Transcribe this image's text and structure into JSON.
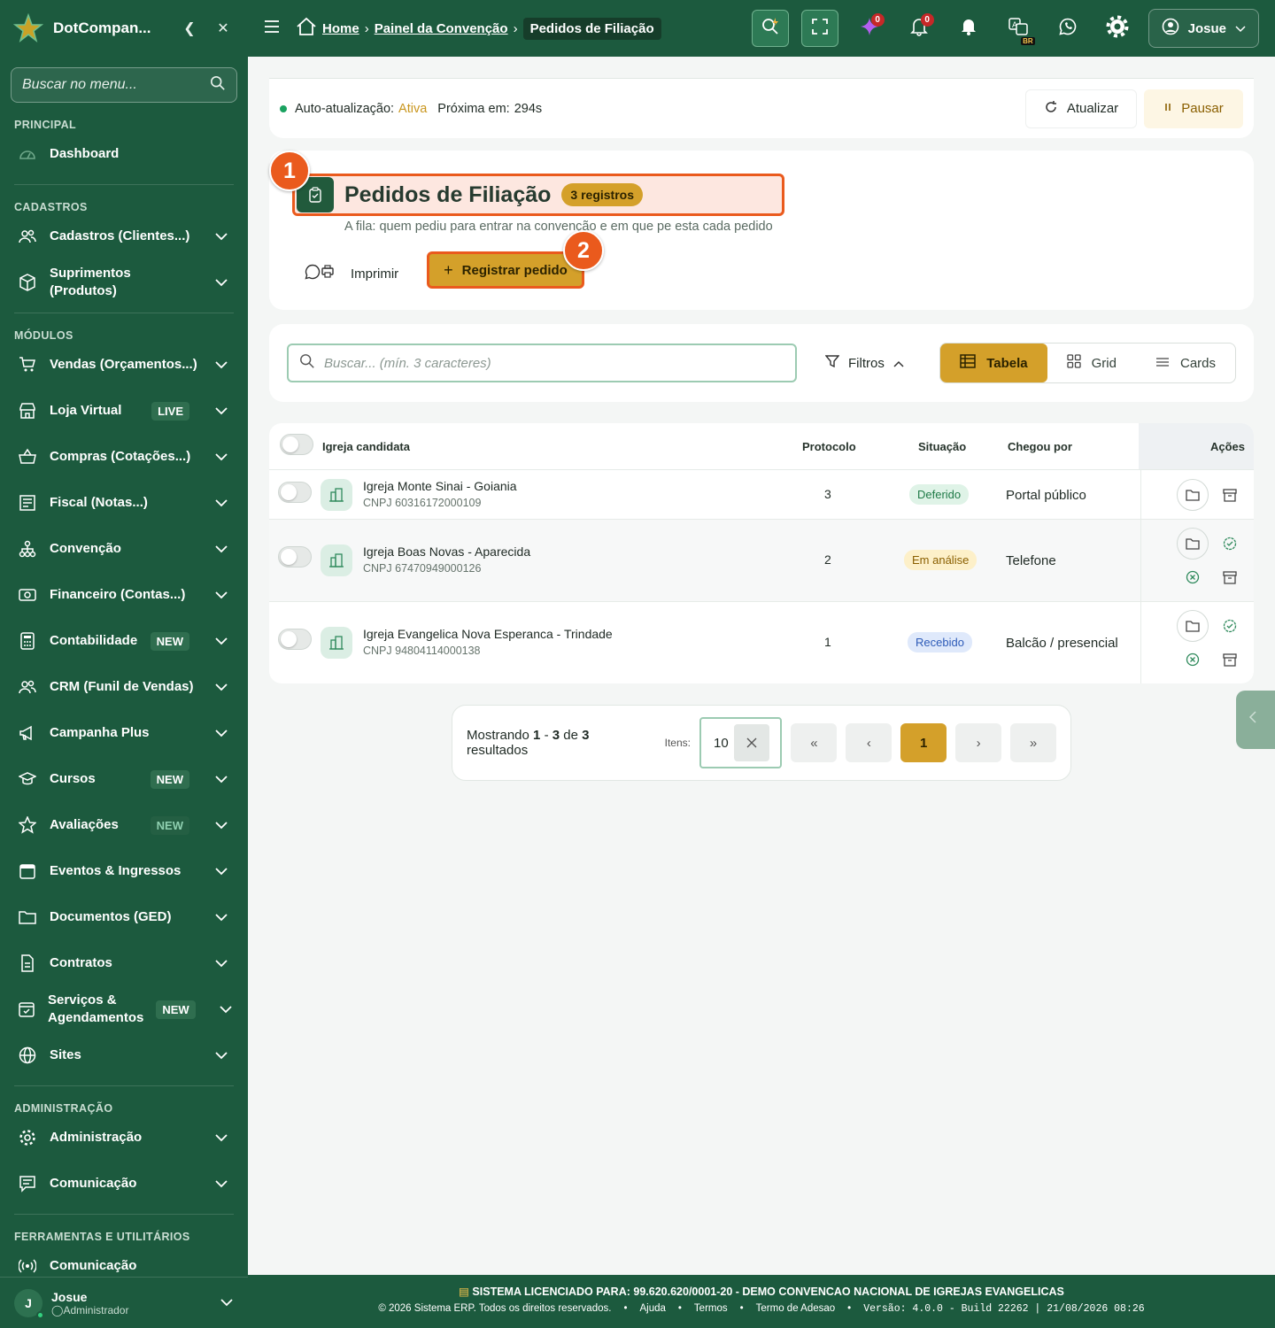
{
  "sidebar": {
    "brand": "DotCompan...",
    "search_placeholder": "Buscar no menu...",
    "sections": {
      "principal": "PRINCIPAL",
      "cadastros": "CADASTROS",
      "modulos": "MÓDULOS",
      "administracao": "ADMINISTRAÇÃO",
      "ferramentas": "FERRAMENTAS E UTILITÁRIOS"
    },
    "items": {
      "dashboard": "Dashboard",
      "cadastros": "Cadastros (Clientes...)",
      "suprimentos": "Suprimentos (Produtos)",
      "vendas": "Vendas (Orçamentos...)",
      "loja": "Loja Virtual",
      "compras": "Compras (Cotações...)",
      "fiscal": "Fiscal (Notas...)",
      "convencao": "Convenção",
      "financeiro": "Financeiro (Contas...)",
      "contabilidade": "Contabilidade",
      "crm": "CRM (Funil de Vendas)",
      "campanha": "Campanha Plus",
      "cursos": "Cursos",
      "avaliacoes": "Avaliações",
      "eventos": "Eventos & Ingressos",
      "documentos": "Documentos (GED)",
      "contratos": "Contratos",
      "servicos": "Serviços & Agendamentos",
      "sites": "Sites",
      "administracao": "Administração",
      "comunicacao_admin": "Comunicação",
      "comunicacao_tools": "Comunicação"
    },
    "badges": {
      "live": "LIVE",
      "new": "NEW"
    },
    "user": {
      "initial": "J",
      "name": "Josue",
      "role": "Administrador"
    }
  },
  "topbar": {
    "breadcrumb": {
      "home": "Home",
      "painel": "Painel da Convenção",
      "current": "Pedidos de Filiação"
    },
    "ai_count": "0",
    "notif_count": "0",
    "lang_badge": "BR",
    "user_name": "Josue"
  },
  "autorefresh": {
    "label": "Auto-atualização:",
    "status": "Ativa",
    "next_label": "Próxima em:",
    "next_value": "294s",
    "refresh_btn": "Atualizar",
    "pause_btn": "Pausar"
  },
  "header": {
    "title": "Pedidos de Filiação",
    "count_badge": "3 registros",
    "subtitle": "A fila: quem pediu para entrar na convenção e em que pe esta cada pedido",
    "print_btn": "Imprimir",
    "register_btn": "Registrar pedido",
    "marker1": "1",
    "marker2": "2"
  },
  "toolbar": {
    "search_placeholder": "Buscar... (mín. 3 caracteres)",
    "filters": "Filtros",
    "views": {
      "table": "Tabela",
      "grid": "Grid",
      "cards": "Cards"
    }
  },
  "table": {
    "headers": {
      "church": "Igreja candidata",
      "protocol": "Protocolo",
      "status": "Situação",
      "channel": "Chegou por",
      "actions": "Ações"
    },
    "rows": [
      {
        "name": "Igreja Monte Sinai - Goiania",
        "cnpj": "CNPJ 60316172000109",
        "protocol": "3",
        "status": "Deferido",
        "channel": "Portal público"
      },
      {
        "name": "Igreja Boas Novas - Aparecida",
        "cnpj": "CNPJ 67470949000126",
        "protocol": "2",
        "status": "Em análise",
        "channel": "Telefone"
      },
      {
        "name": "Igreja Evangelica Nova Esperanca - Trindade",
        "cnpj": "CNPJ 94804114000138",
        "protocol": "1",
        "status": "Recebido",
        "channel": "Balcão / presencial"
      }
    ],
    "status_colors": {
      "deferido": "#dff3e7",
      "analise": "#fdf0c9",
      "recebido": "#dfe9fb"
    }
  },
  "pagination": {
    "showing_prefix": "Mostrando",
    "range_start": "1",
    "range_sep": "-",
    "range_end": "3",
    "of": "de",
    "total": "3",
    "results": "resultados",
    "items_label": "Itens:",
    "page_size": "10",
    "current_page": "1"
  },
  "footer": {
    "license_label": "SISTEMA LICENCIADO PARA:",
    "license_value": "99.620.620/0001-20 - DEMO CONVENCAO NACIONAL DE IGREJAS EVANGELICAS",
    "copyright": "© 2026 Sistema ERP. Todos os direitos reservados.",
    "help": "Ajuda",
    "terms": "Termos",
    "adhesion": "Termo de Adesao",
    "version": "Versão: 4.0.0 - Build 22262 | 21/08/2026 08:26"
  },
  "colors": {
    "primary": "#1c5a3e",
    "accent": "#d4a02a",
    "highlight": "#ea5a1d"
  }
}
